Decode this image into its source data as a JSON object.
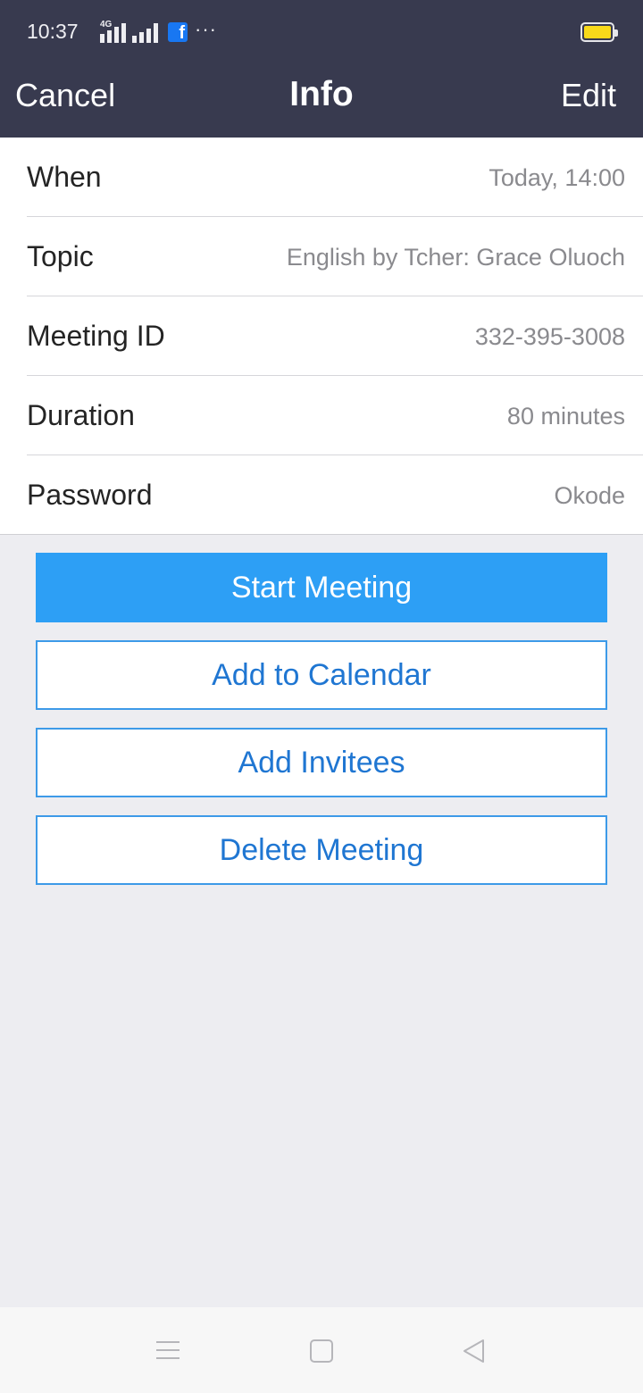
{
  "status_bar": {
    "time": "10:37",
    "network": "4G",
    "notification_app": "facebook",
    "more": "···",
    "battery_color": "#f8d91a"
  },
  "header": {
    "cancel_label": "Cancel",
    "title": "Info",
    "edit_label": "Edit",
    "background": "#383a4f"
  },
  "details": [
    {
      "label": "When",
      "value": "Today, 14:00"
    },
    {
      "label": "Topic",
      "value": "English by Tcher: Grace Oluoch"
    },
    {
      "label": "Meeting ID",
      "value": "332-395-3008"
    },
    {
      "label": "Duration",
      "value": "80 minutes"
    },
    {
      "label": "Password",
      "value": "Okode"
    }
  ],
  "actions": {
    "start": "Start Meeting",
    "add_calendar": "Add to Calendar",
    "add_invitees": "Add Invitees",
    "delete": "Delete Meeting"
  },
  "colors": {
    "accent": "#2d9ff5",
    "link": "#1f76d2"
  },
  "system_nav": {
    "menu_icon": "menu-icon",
    "home_icon": "home-icon",
    "back_icon": "back-icon"
  }
}
